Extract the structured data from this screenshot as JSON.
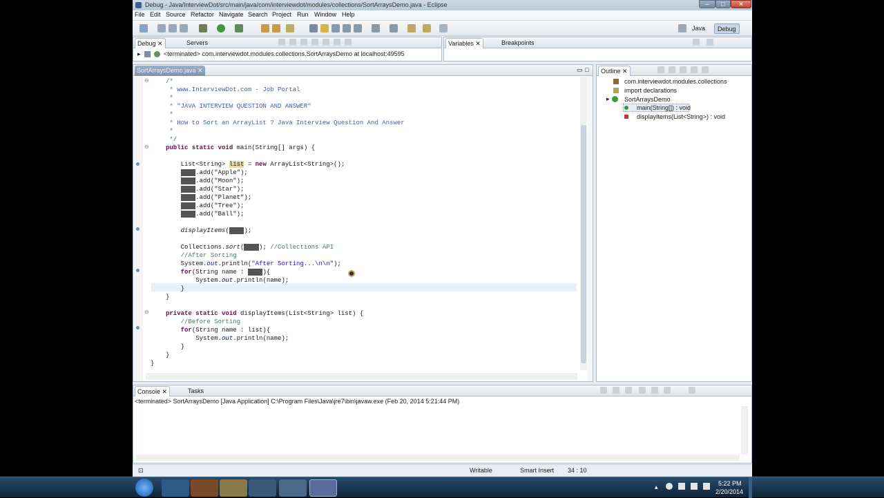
{
  "window": {
    "title": "Debug - Java/InterviewDot/src/main/java/com/interviewdot/modules/collections/SortArraysDemo.java - Eclipse",
    "buttons": {
      "minimize": "─",
      "maximize": "□",
      "close": "✕"
    }
  },
  "menu": [
    "File",
    "Edit",
    "Source",
    "Refactor",
    "Navigate",
    "Search",
    "Project",
    "Run",
    "Window",
    "Help"
  ],
  "perspectives": {
    "java": "Java",
    "debug": "Debug"
  },
  "debug_view": {
    "tabs": [
      "Debug",
      "Servers"
    ],
    "terminated": "<terminated> com.interviewdot.modules.collections.SortArraysDemo at localhost:49595"
  },
  "vars_view": {
    "tabs": [
      "Variables",
      "Breakpoints"
    ]
  },
  "editor": {
    "tab": "SortArraysDemo.java",
    "lines": {
      "l1": "/*",
      "l2": " * www.InterviewDot.com - Job Portal",
      "l3": " *",
      "l4": " * \"JAVA INTERVIEW QUESTION AND ANSWER\"",
      "l5": " *",
      "l6": " * How to Sort an ArrayList ? Java Interview Question And Answer",
      "l7": " *",
      "l8": " */",
      "main_kw": "public static void",
      "main_rest": " main(String[] args) {",
      "decl_a": "List<String> ",
      "decl_var": "list",
      "decl_b": " = ",
      "decl_new": "new",
      "decl_c": " ArrayList<String>();",
      "var": "list",
      "adds": [
        ".add(\"Apple\");",
        ".add(\"Moon\");",
        ".add(\"Star\");",
        ".add(\"Planet\");",
        ".add(\"Tree\");",
        ".add(\"Ball\");"
      ],
      "display_call": "displayItems",
      "display_end": ");",
      "sort_a": "Collections.",
      "sort_b": "sort",
      "sort_c": "); ",
      "sort_cm": "//Collections API",
      "after_cm": "//After Sorting",
      "println_a": "System.",
      "println_out": "out",
      "println_b": ".println(",
      "println_str": "\"After Sorting...\\n\\n\"",
      "println_c": ");",
      "for_kw": "for",
      "for_a": "(String name : ",
      "for_b": "){",
      "print_name": ".println(name);",
      "close": "}",
      "priv_kw": "private static void",
      "priv_rest": " displayItems(List<String> list) {",
      "before_cm": "//Before Sorting",
      "for_c": "(String name : list){"
    }
  },
  "outline": {
    "tab": "Outline",
    "items": [
      "com.interviewdot.modules.collections",
      "import declarations",
      "SortArraysDemo",
      "main(String[]) : void",
      "displayItems(List<String>) : void"
    ]
  },
  "console": {
    "tabs": [
      "Console",
      "Tasks"
    ],
    "terminated": "<terminated> SortArraysDemo [Java Application] C:\\Program Files\\Java\\jre7\\bin\\javaw.exe (Feb 20, 2014 5:21:44 PM)"
  },
  "status": {
    "writable": "Writable",
    "insert": "Smart Insert",
    "position": "34 : 10"
  },
  "taskbar": {
    "time": "5:22 PM",
    "date": "2/20/2014"
  }
}
